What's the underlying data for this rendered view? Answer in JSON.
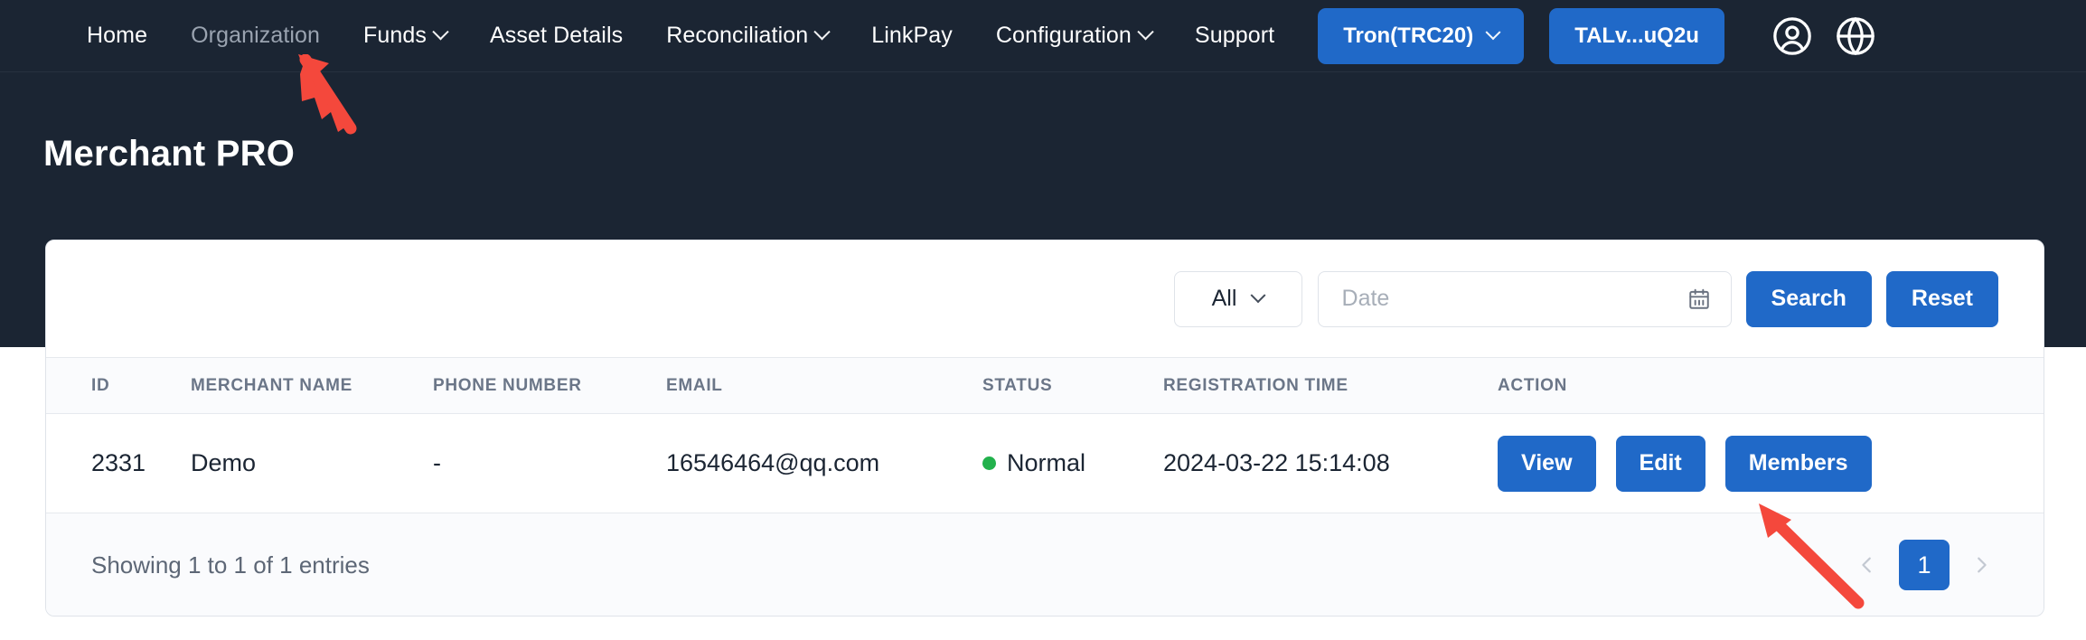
{
  "navbar": {
    "links": [
      {
        "label": "Home",
        "icon": "",
        "muted": false,
        "has_caret": false
      },
      {
        "label": "Organization",
        "icon": "",
        "muted": true,
        "has_caret": false
      },
      {
        "label": "Funds",
        "icon": "chevron-down-icon",
        "muted": false,
        "has_caret": true
      },
      {
        "label": "Asset Details",
        "icon": "",
        "muted": false,
        "has_caret": false
      },
      {
        "label": "Reconciliation",
        "icon": "chevron-down-icon",
        "muted": false,
        "has_caret": true
      },
      {
        "label": "LinkPay",
        "icon": "",
        "muted": false,
        "has_caret": false
      },
      {
        "label": "Configuration",
        "icon": "chevron-down-icon",
        "muted": false,
        "has_caret": true
      },
      {
        "label": "Support",
        "icon": "",
        "muted": false,
        "has_caret": false
      }
    ],
    "network_button": "Tron(TRC20)",
    "wallet_button": "TALv...uQ2u",
    "account_icon": "user-circle-icon",
    "language_icon": "globe-icon",
    "accent_color": "#2069c8",
    "background_color": "#1b2533"
  },
  "page": {
    "title": "Merchant PRO"
  },
  "filters": {
    "status_select": "All",
    "date_placeholder": "Date",
    "date_value": "",
    "calendar_icon": "calendar-icon",
    "search_label": "Search",
    "reset_label": "Reset"
  },
  "table": {
    "columns": [
      "ID",
      "MERCHANT NAME",
      "PHONE NUMBER",
      "EMAIL",
      "STATUS",
      "REGISTRATION TIME",
      "ACTION"
    ],
    "rows": [
      {
        "id": "2331",
        "merchant_name": "Demo",
        "phone_number": "-",
        "email": "16546464@qq.com",
        "status": "Normal",
        "status_color": "#22b14c",
        "registration_time": "2024-03-22 15:14:08",
        "actions": [
          "View",
          "Edit",
          "Members"
        ]
      }
    ]
  },
  "footer": {
    "entries_text": "Showing 1 to 1 of 1 entries",
    "prev_icon": "chevron-left-icon",
    "next_icon": "chevron-right-icon",
    "current_page": "1"
  },
  "annotations": {
    "color": "#f4483c",
    "arrow_1_target": "Organization",
    "arrow_2_target": "Members"
  }
}
